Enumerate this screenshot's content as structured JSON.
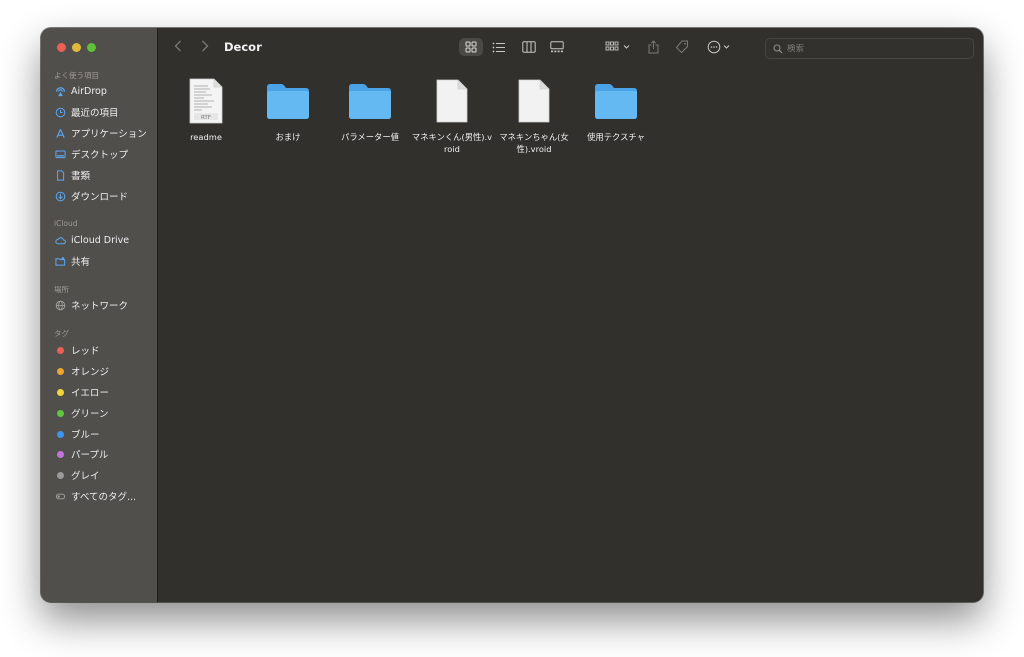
{
  "window": {
    "title": "Decor"
  },
  "sidebar": {
    "favorites_header": "よく使う項目",
    "favorites": [
      {
        "label": "AirDrop",
        "icon": "airdrop-icon"
      },
      {
        "label": "最近の項目",
        "icon": "clock-icon"
      },
      {
        "label": "アプリケーション",
        "icon": "applications-icon"
      },
      {
        "label": "デスクトップ",
        "icon": "desktop-icon"
      },
      {
        "label": "書類",
        "icon": "document-icon"
      },
      {
        "label": "ダウンロード",
        "icon": "download-icon"
      }
    ],
    "icloud_header": "iCloud",
    "icloud": [
      {
        "label": "iCloud Drive",
        "icon": "cloud-icon"
      },
      {
        "label": "共有",
        "icon": "shared-folder-icon"
      }
    ],
    "locations_header": "場所",
    "locations": [
      {
        "label": "ネットワーク",
        "icon": "globe-icon"
      }
    ],
    "tags_header": "タグ",
    "tags": [
      {
        "label": "レッド",
        "color": "#ec5f57"
      },
      {
        "label": "オレンジ",
        "color": "#f0a732"
      },
      {
        "label": "イエロー",
        "color": "#f4d63b"
      },
      {
        "label": "グリーン",
        "color": "#5fc73d"
      },
      {
        "label": "ブルー",
        "color": "#3a95f0"
      },
      {
        "label": "パープル",
        "color": "#c574db"
      },
      {
        "label": "グレイ",
        "color": "#9a9a9a"
      },
      {
        "label": "すべてのタグ...",
        "color": ""
      }
    ]
  },
  "toolbar": {
    "search_placeholder": "検索"
  },
  "files": [
    {
      "name": "readme",
      "kind": "rtf",
      "icon": "rtf-document-icon"
    },
    {
      "name": "おまけ",
      "kind": "folder",
      "icon": "folder-icon"
    },
    {
      "name": "パラメーター値",
      "kind": "folder",
      "icon": "folder-icon"
    },
    {
      "name": "マネキンくん(男性).vroid",
      "kind": "document",
      "icon": "blank-document-icon"
    },
    {
      "name": "マネキンちゃん(女性).vroid",
      "kind": "document",
      "icon": "blank-document-icon"
    },
    {
      "name": "使用テクスチャ",
      "kind": "folder",
      "icon": "folder-icon"
    }
  ],
  "colors": {
    "folder": "#5db4f0",
    "sidebar_bg": "#514f4c",
    "content_bg": "#31302d"
  }
}
